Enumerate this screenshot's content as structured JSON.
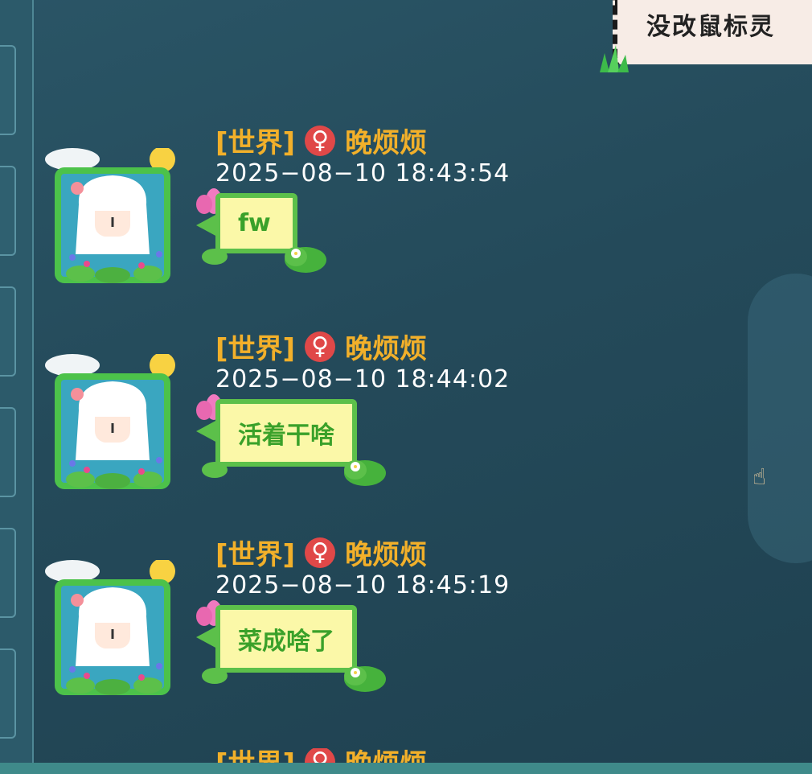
{
  "banner": {
    "text": "没改鼠标灵"
  },
  "messages": [
    {
      "channel": "[世界]",
      "gender_icon": "♀",
      "name": "晚烦烦",
      "time": "2025−08−10   18:43:54",
      "text": "fw"
    },
    {
      "channel": "[世界]",
      "gender_icon": "♀",
      "name": "晚烦烦",
      "time": "2025−08−10   18:44:02",
      "text": "活着干啥"
    },
    {
      "channel": "[世界]",
      "gender_icon": "♀",
      "name": "晚烦烦",
      "time": "2025−08−10   18:45:19",
      "text": "菜成啥了"
    },
    {
      "channel": "[世界]",
      "gender_icon": "♀",
      "name": "晚烦烦"
    }
  ],
  "colors": {
    "name_color": "#f2b02a",
    "bubble_fill": "#fbf8a8",
    "bubble_border": "#5cc04a",
    "bubble_text": "#3aa12a",
    "background": "#244a5a"
  }
}
